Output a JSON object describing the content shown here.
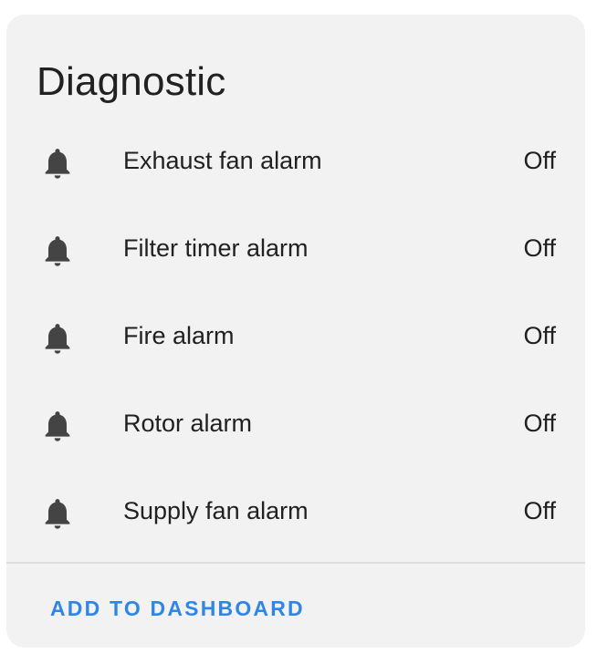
{
  "card": {
    "title": "Diagnostic",
    "rows": [
      {
        "icon": "bell-icon",
        "label": "Exhaust fan alarm",
        "state": "Off"
      },
      {
        "icon": "bell-icon",
        "label": "Filter timer alarm",
        "state": "Off"
      },
      {
        "icon": "bell-icon",
        "label": "Fire alarm",
        "state": "Off"
      },
      {
        "icon": "bell-icon",
        "label": "Rotor alarm",
        "state": "Off"
      },
      {
        "icon": "bell-icon",
        "label": "Supply fan alarm",
        "state": "Off"
      }
    ],
    "action_label": "ADD TO DASHBOARD"
  },
  "colors": {
    "card_background": "#f2f2f2",
    "text": "#212121",
    "icon": "#444444",
    "accent": "#2f86e6",
    "divider": "#dcdcdc"
  }
}
